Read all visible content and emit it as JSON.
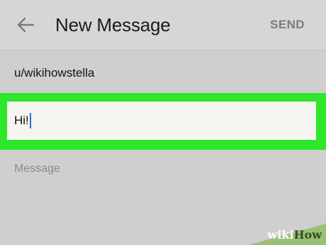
{
  "header": {
    "title": "New Message",
    "send_label": "SEND",
    "back_icon": "arrow-left-icon"
  },
  "form": {
    "recipient_value": "u/wikihowstella",
    "subject_value": "Hi!",
    "message_placeholder": "Message"
  },
  "watermark": {
    "part1": "wiki",
    "part2": "How"
  },
  "colors": {
    "highlight": "#2ee62a",
    "background": "#cfcfcf",
    "caret": "#2d6fd6"
  }
}
